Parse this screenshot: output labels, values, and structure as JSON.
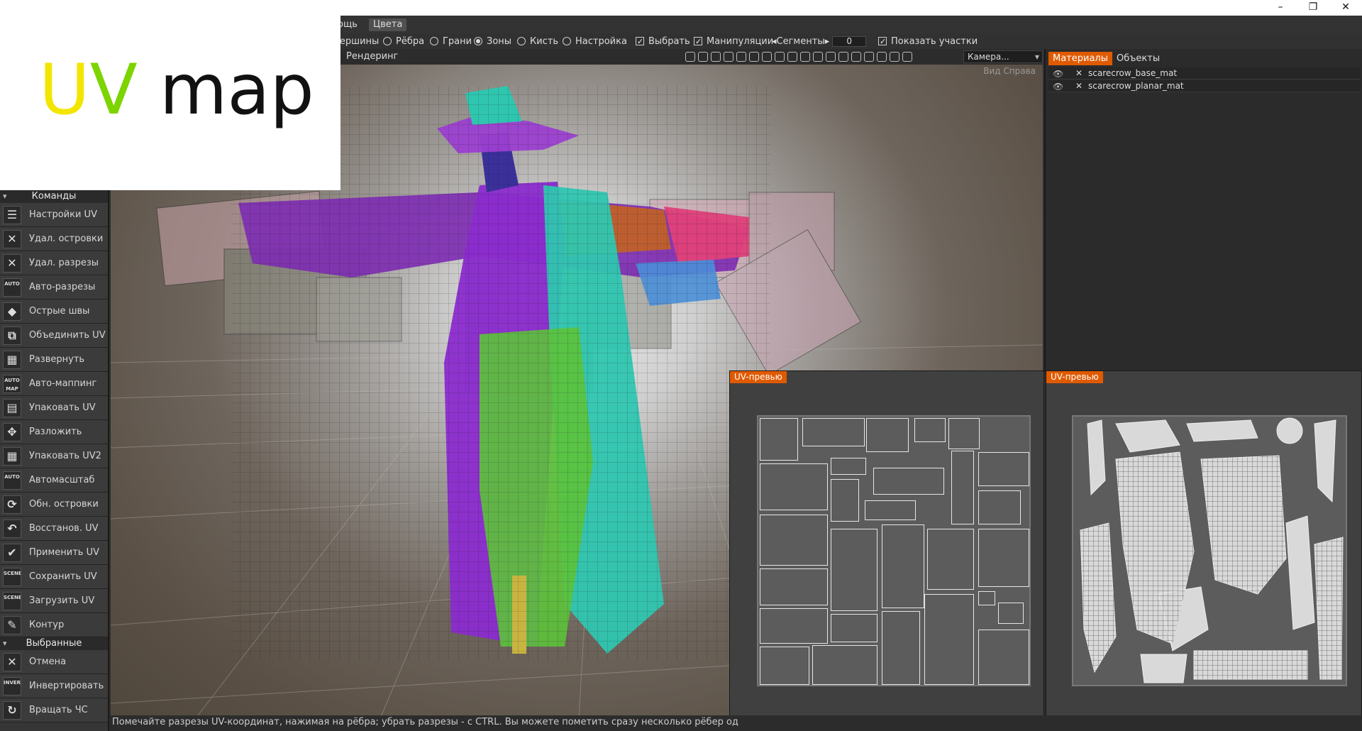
{
  "overlay": {
    "title_u": "U",
    "title_v": "V",
    "title_rest": " map"
  },
  "window_controls": {
    "minimize": "–",
    "restore": "❐",
    "close": "✕"
  },
  "menubar": {
    "items": [
      "ощь",
      "Цвета"
    ]
  },
  "modebar": {
    "vertices": "Вершины",
    "edges": "Рёбра",
    "faces": "Грани",
    "zones": "Зоны",
    "brush": "Кисть",
    "settings": "Настройка",
    "select": "Выбрать",
    "manipulate": "Манипуляции",
    "segments": "◂Сегменты▸",
    "segments_value": "0",
    "show_islands": "Показать участки"
  },
  "toolbar": {
    "render": "Рендеринг",
    "camera": "Камера..."
  },
  "viewport": {
    "view_label": "Вид Справа"
  },
  "sidebar": {
    "commands_header": "Команды",
    "commands": [
      {
        "label": "Настройки UV",
        "icon": "sliders-icon",
        "glyph": "☰"
      },
      {
        "label": "Удал. островки",
        "icon": "delete-islands-icon",
        "glyph": "✕"
      },
      {
        "label": "Удал. разрезы",
        "icon": "delete-seams-icon",
        "glyph": "✕"
      },
      {
        "label": "Авто-разрезы",
        "icon": "auto-seams-icon",
        "glyph": "AUTO"
      },
      {
        "label": "Острые швы",
        "icon": "sharp-seams-icon",
        "glyph": "◆"
      },
      {
        "label": "Объединить UV",
        "icon": "merge-uv-icon",
        "glyph": "⧉"
      },
      {
        "label": "Развернуть",
        "icon": "unwrap-icon",
        "glyph": "▦"
      },
      {
        "label": "Авто-маппинг",
        "icon": "auto-map-icon",
        "glyph": "AUTO MAP"
      },
      {
        "label": "Упаковать UV",
        "icon": "pack-uv-icon",
        "glyph": "▤"
      },
      {
        "label": "Разложить",
        "icon": "unfold-icon",
        "glyph": "✥"
      },
      {
        "label": "Упаковать UV2",
        "icon": "pack-uv2-icon",
        "glyph": "▦"
      },
      {
        "label": "Автомасштаб",
        "icon": "auto-scale-icon",
        "glyph": "AUTO"
      },
      {
        "label": "Обн. островки",
        "icon": "refresh-islands-icon",
        "glyph": "⟳"
      },
      {
        "label": "Восстанов. UV",
        "icon": "restore-uv-icon",
        "glyph": "↶"
      },
      {
        "label": "Применить UV",
        "icon": "apply-uv-icon",
        "glyph": "✔"
      },
      {
        "label": "Сохранить UV",
        "icon": "save-uv-icon",
        "glyph": "SCENE"
      },
      {
        "label": "Загрузить UV",
        "icon": "load-uv-icon",
        "glyph": "SCENE"
      },
      {
        "label": "Контур",
        "icon": "contour-icon",
        "glyph": "✎"
      }
    ],
    "selected_header": "Выбранные",
    "selected": [
      {
        "label": "Отмена",
        "icon": "cancel-icon",
        "glyph": "✕"
      },
      {
        "label": "Инвертировать",
        "icon": "invert-icon",
        "glyph": "INVERT"
      },
      {
        "label": "Вращать ЧС",
        "icon": "rotate-cw-icon",
        "glyph": "↻"
      }
    ]
  },
  "right_panel": {
    "tabs": [
      "Материалы",
      "Объекты"
    ],
    "materials": [
      "scarecrow_base_mat",
      "scarecrow_planar_mat"
    ]
  },
  "uv_previews": {
    "left_title": "UV-превью",
    "right_title": "UV-превью"
  },
  "status": "Помечайте разрезы UV-координат, нажимая на рёбра; убрать разрезы - с CTRL. Вы можете пометить сразу несколько рёбер од",
  "colors": {
    "accent": "#e05a00",
    "purple": "#8a2bd1",
    "teal": "#2fc6b0",
    "green": "#5cc23a",
    "pink": "#e0407a"
  }
}
